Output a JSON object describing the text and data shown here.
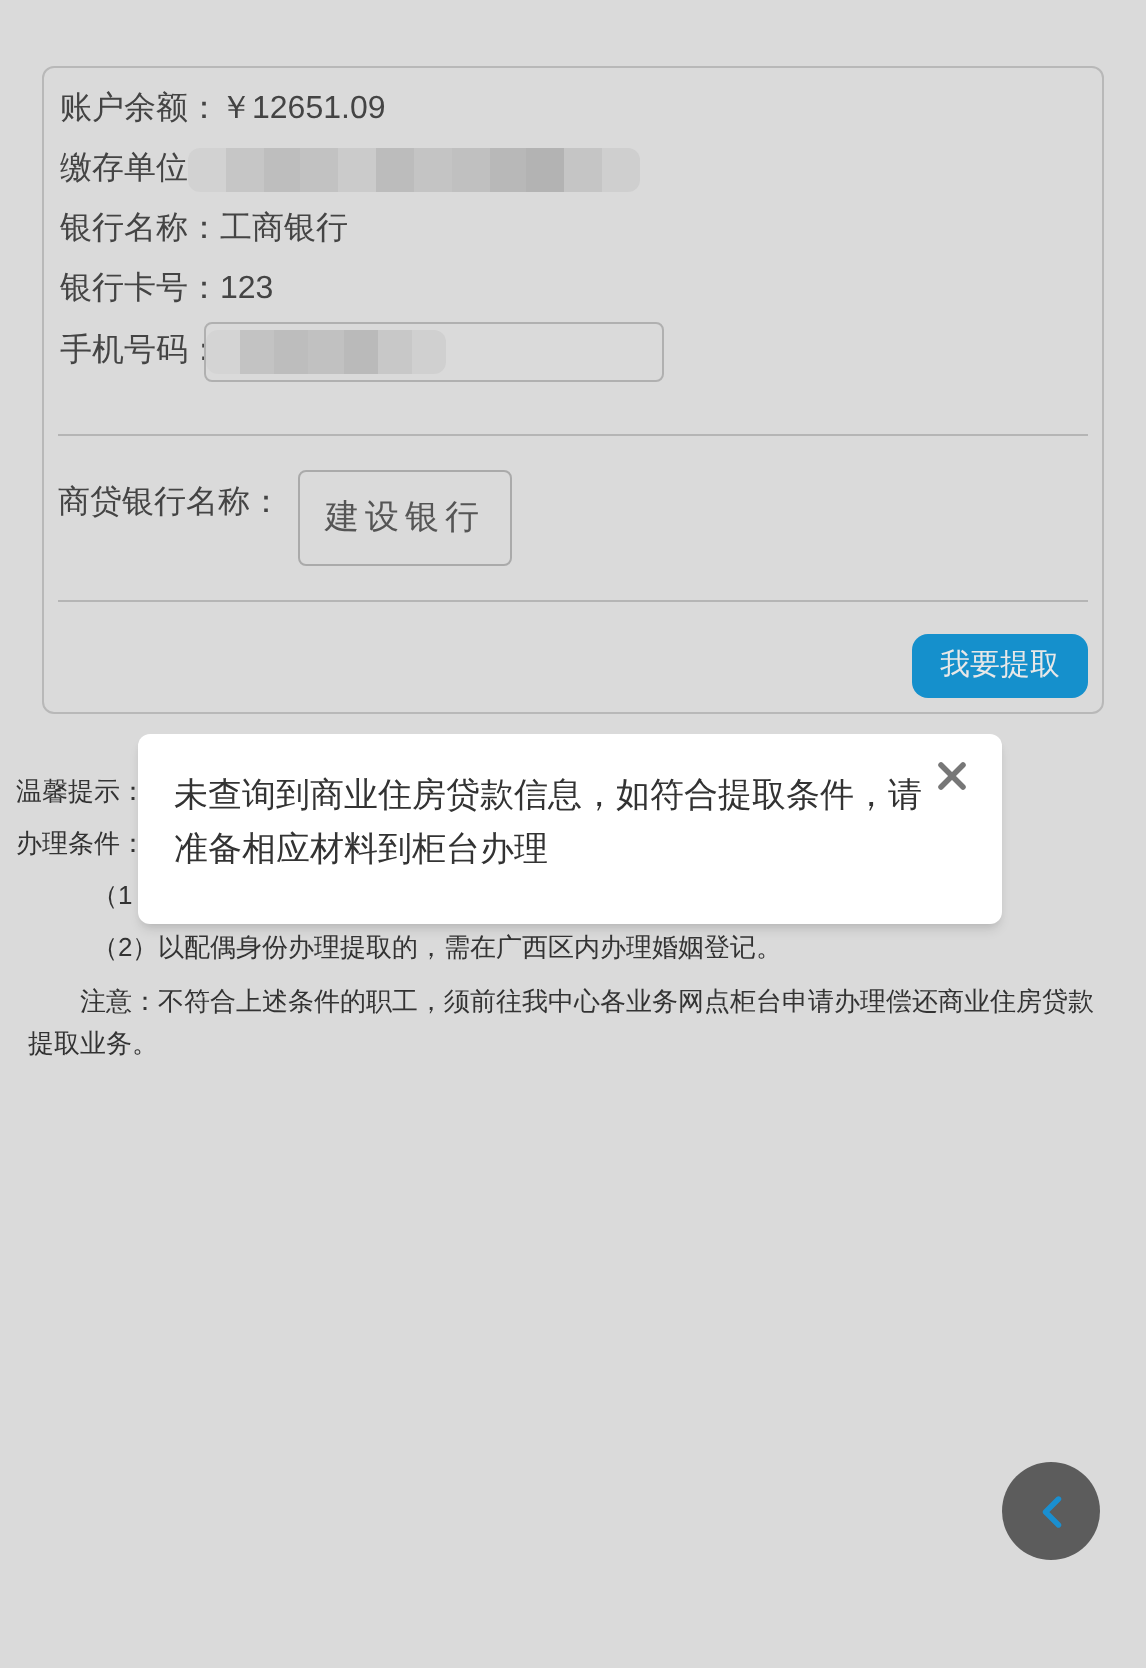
{
  "account": {
    "fields": [
      {
        "label": "账户余额：",
        "value": "￥12651.09",
        "kind": "text"
      },
      {
        "label": "缴存单位",
        "kind": "redacted"
      },
      {
        "label": "银行名称：",
        "value": "工商银行",
        "kind": "text"
      },
      {
        "label": "银行卡号：",
        "value": "123",
        "kind": "text"
      },
      {
        "label": "手机号码：",
        "kind": "redacted_input"
      }
    ],
    "loan_bank": {
      "label": "商贷银行名称：",
      "value": "建设银行"
    },
    "submit_button": "我要提取"
  },
  "notes": [
    {
      "kind": "plain",
      "text": "温馨提示："
    },
    {
      "kind": "plain",
      "text": "办理条件："
    },
    {
      "kind": "item",
      "text": "（1"
    },
    {
      "kind": "item",
      "text": "（2）以配偶身份办理提取的，需在广西区内办理婚姻登记。"
    },
    {
      "kind": "note",
      "text": "注意：不符合上述条件的职工，须前往我中心各业务网点柜台申请办理偿还商业住房贷款提取业务。"
    }
  ],
  "dialog": {
    "message": "未查询到商业住房贷款信息，如符合提取条件，请准备相应材料到柜台办理"
  }
}
